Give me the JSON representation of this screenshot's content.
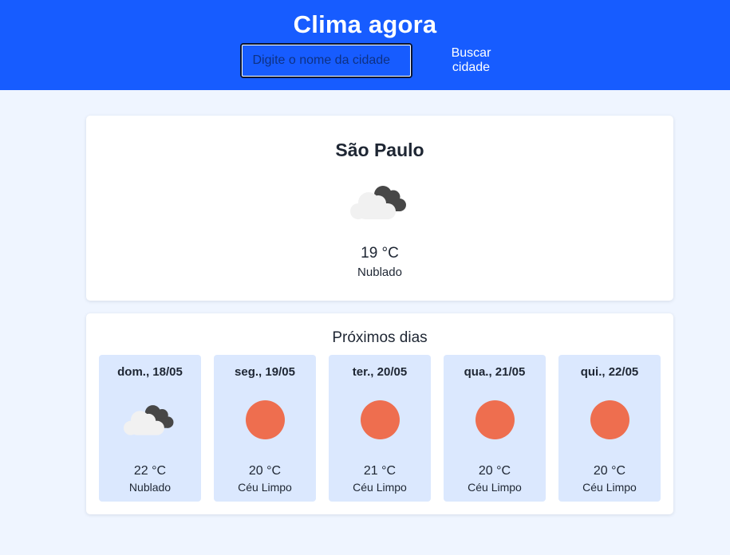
{
  "header": {
    "title": "Clima agora",
    "search_placeholder": "Digite o nome da cidade",
    "search_value": "",
    "search_button_label": "Buscar cidade"
  },
  "current": {
    "city": "São Paulo",
    "icon": "cloudy-icon",
    "temperature": "19 °C",
    "description": "Nublado"
  },
  "forecast": {
    "title": "Próximos dias",
    "days": [
      {
        "date": "dom., 18/05",
        "icon": "cloudy-icon",
        "temperature": "22 °C",
        "description": "Nublado"
      },
      {
        "date": "seg., 19/05",
        "icon": "sun-icon",
        "temperature": "20 °C",
        "description": "Céu Limpo"
      },
      {
        "date": "ter., 20/05",
        "icon": "sun-icon",
        "temperature": "21 °C",
        "description": "Céu Limpo"
      },
      {
        "date": "qua., 21/05",
        "icon": "sun-icon",
        "temperature": "20 °C",
        "description": "Céu Limpo"
      },
      {
        "date": "qui., 22/05",
        "icon": "sun-icon",
        "temperature": "20 °C",
        "description": "Céu Limpo"
      }
    ]
  },
  "colors": {
    "header_bg": "#175cff",
    "page_bg": "#eff5ff",
    "day_card_bg": "#dbe8fe",
    "sun": "#ee6e4f",
    "cloud_light": "#f1f1f1",
    "cloud_dark": "#474747"
  }
}
